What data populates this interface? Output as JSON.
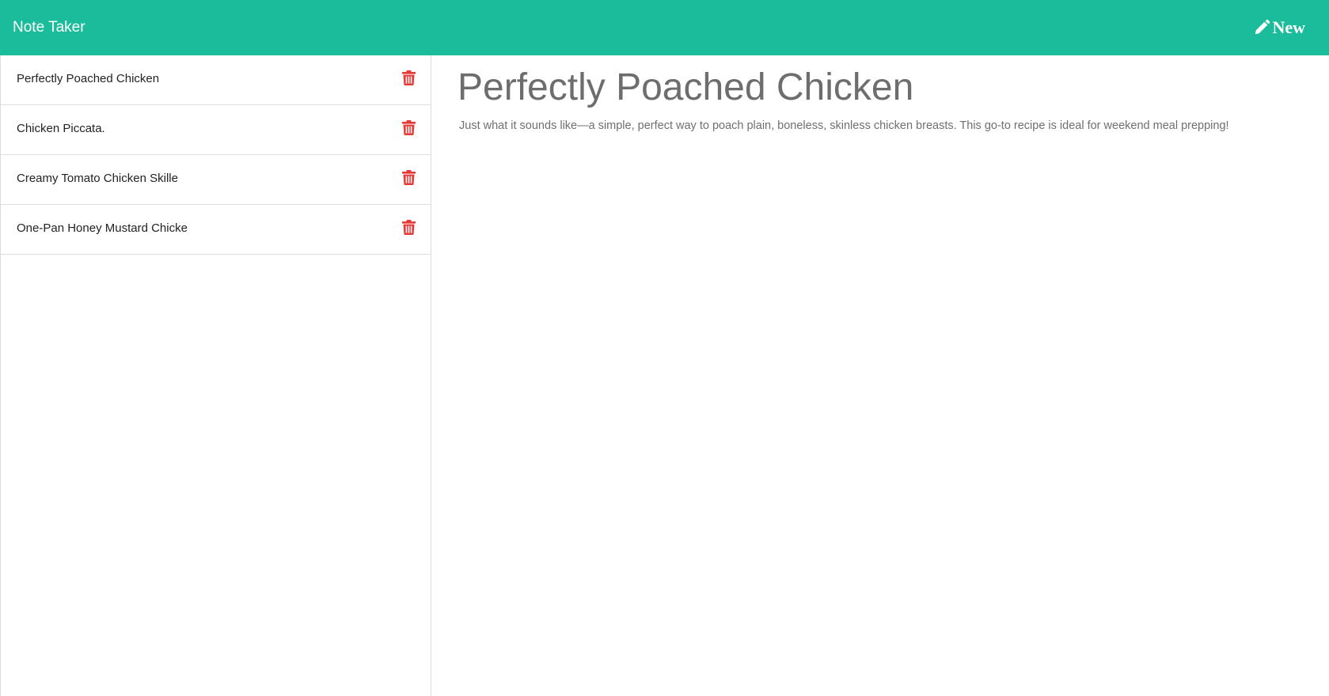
{
  "app": {
    "title": "Note Taker",
    "accent_color": "#1abc9c",
    "delete_color": "#e53935"
  },
  "header": {
    "new_button_label": "New",
    "new_button_icon": "pencil-icon"
  },
  "notes": [
    {
      "title": "Perfectly Poached Chicken",
      "delete_icon": "trash-icon"
    },
    {
      "title": "Chicken Piccata.",
      "delete_icon": "trash-icon"
    },
    {
      "title": "Creamy Tomato Chicken Skille",
      "delete_icon": "trash-icon"
    },
    {
      "title": "One-Pan Honey Mustard Chicke",
      "delete_icon": "trash-icon"
    }
  ],
  "active_note": {
    "title": "Perfectly Poached Chicken",
    "text": "Just what it sounds like—a simple, perfect way to poach plain, boneless, skinless chicken breasts. This go-to recipe is ideal for weekend meal prepping!"
  }
}
